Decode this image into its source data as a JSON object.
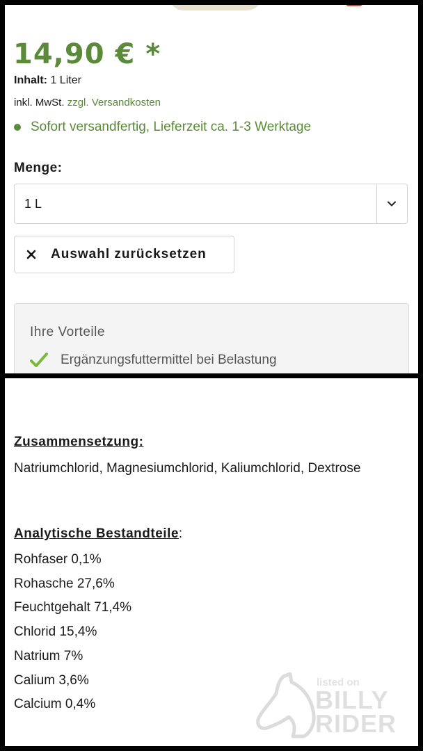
{
  "colors": {
    "accent": "#5a8a3a",
    "checkmark": "#7cb83a"
  },
  "product": {
    "price": "14,90 € *",
    "content_label": "Inhalt:",
    "content_value": "1 Liter",
    "tax_text": "inkl. MwSt.",
    "shipping_link": "zzgl. Versandkosten",
    "availability": "Sofort versandfertig, Lieferzeit ca. 1-3 Werktage"
  },
  "quantity": {
    "label": "Menge:",
    "selected": "1 L",
    "chevron_icon": "chevron-down-icon"
  },
  "reset": {
    "icon": "close-icon",
    "label": "Auswahl zurücksetzen"
  },
  "benefits": {
    "title": "Ihre Vorteile",
    "items": [
      {
        "icon": "checkmark-icon",
        "text": "Ergänzungsfuttermittel bei Belastung"
      }
    ]
  },
  "composition": {
    "heading": "Zusammensetzung:",
    "text": "Natriumchlorid, Magnesiumchlorid, Kaliumchlorid, Dextrose"
  },
  "analytics": {
    "heading": "Analytische Bestandteile",
    "suffix": ":",
    "items": [
      "Rohfaser 0,1%",
      "Rohasche 27,6%",
      "Feuchtgehalt 71,4%",
      "Chlorid 15,4%",
      "Natrium 7%",
      "Calium 3,6%",
      "Calcium 0,4%"
    ]
  },
  "watermark": {
    "line1": "listed on",
    "line2": "BILLY",
    "line3": "RIDER"
  }
}
